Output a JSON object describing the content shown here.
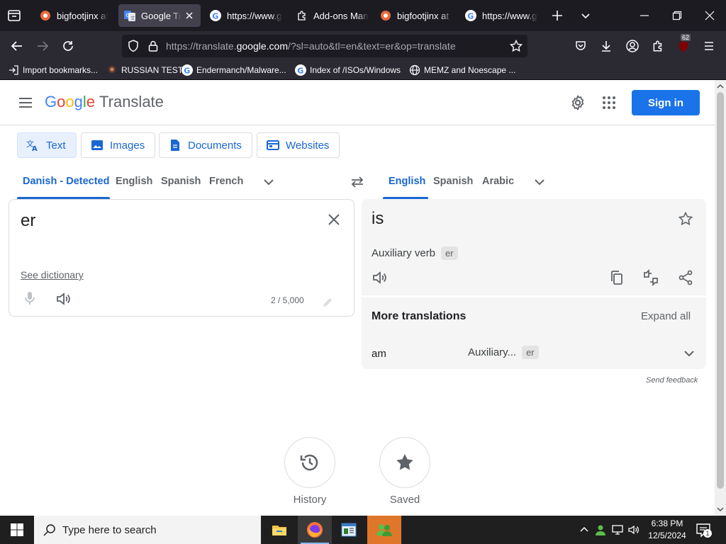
{
  "browser": {
    "tabs": [
      {
        "title": "bigfootjinx at DeviantArt",
        "favicon": "deviantart-icon",
        "active": false
      },
      {
        "title": "Google Translate",
        "favicon": "google-translate-icon",
        "active": true
      },
      {
        "title": "https://www.google.com",
        "favicon": "google-icon",
        "active": false
      },
      {
        "title": "Add-ons Manager",
        "favicon": "puzzle-icon",
        "active": false
      },
      {
        "title": "bigfootjinx at DeviantArt",
        "favicon": "deviantart-icon",
        "active": false
      },
      {
        "title": "https://www.google.com",
        "favicon": "google-icon",
        "active": false
      }
    ],
    "url": {
      "prefix": "https://translate.",
      "domain": "google.com",
      "rest": "/?sl=auto&tl=en&text=er&op=translate"
    },
    "extensions_badge": "62",
    "bookmarks": [
      {
        "label": "Import bookmarks...",
        "icon": "import-icon"
      },
      {
        "label": "RUSSIAN TEST",
        "icon": "person-icon"
      },
      {
        "label": "Endermanch/Malware...",
        "icon": "google-icon"
      },
      {
        "label": "Index of /ISOs/Windows",
        "icon": "google-icon"
      },
      {
        "label": "MEMZ and Noescape ...",
        "icon": "globe-icon"
      }
    ]
  },
  "page": {
    "logo_google": [
      "G",
      "o",
      "o",
      "g",
      "l",
      "e"
    ],
    "logo_product": "Translate",
    "signin_label": "Sign in",
    "modes": [
      {
        "label": "Text",
        "icon": "translate-icon",
        "active": true
      },
      {
        "label": "Images",
        "icon": "image-icon",
        "active": false
      },
      {
        "label": "Documents",
        "icon": "document-icon",
        "active": false
      },
      {
        "label": "Websites",
        "icon": "website-icon",
        "active": false
      }
    ],
    "source_langs": [
      "Danish - Detected",
      "English",
      "Spanish",
      "French"
    ],
    "target_langs": [
      "English",
      "Spanish",
      "Arabic"
    ],
    "source_text": "er",
    "see_dictionary": "See dictionary",
    "char_count": "2 / 5,000",
    "target_text": "is",
    "part_of_speech": "Auxiliary verb",
    "pos_chip": "er",
    "more_translations_title": "More translations",
    "expand_all": "Expand all",
    "alt": {
      "word": "am",
      "pos": "Auxiliary...",
      "chip": "er"
    },
    "send_feedback": "Send feedback",
    "history_label": "History",
    "saved_label": "Saved"
  },
  "taskbar": {
    "search_placeholder": "Type here to search",
    "time": "6:38 PM",
    "date": "12/5/2024",
    "notification_count": "1"
  },
  "colors": {
    "accent": "#1a73e8",
    "selected_lang": "#1967d2",
    "browser_dark": "#1c1b22",
    "taskbar_active": "#e0762a"
  }
}
